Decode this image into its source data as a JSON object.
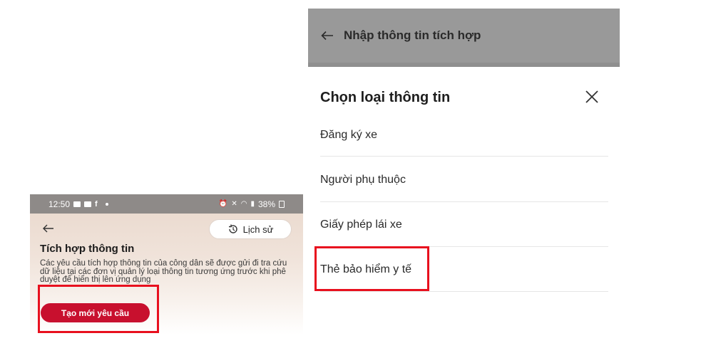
{
  "left_screen": {
    "status_bar": {
      "time": "12:50",
      "battery": "38%"
    },
    "history_button_label": "Lịch sử",
    "title": "Tích hợp thông tin",
    "description": "Các yêu cầu tích hợp thông tin của công dân sẽ được gửi đi tra cứu dữ liệu tại các đơn vị quản lý loại thông tin tương ứng trước khi phê duyệt để hiển thị lên ứng dụng",
    "create_button_label": "Tạo mới yêu cầu"
  },
  "right_screen": {
    "header_title": "Nhập thông tin tích hợp",
    "sheet_title": "Chọn loại thông tin",
    "options": [
      {
        "label": "Đăng ký xe"
      },
      {
        "label": "Người phụ thuộc"
      },
      {
        "label": "Giấy phép lái xe"
      },
      {
        "label": "Thẻ bảo hiểm y tế"
      }
    ]
  },
  "colors": {
    "accent_red": "#c8102e",
    "highlight_red": "#e8101e",
    "header_gray": "#999999"
  }
}
